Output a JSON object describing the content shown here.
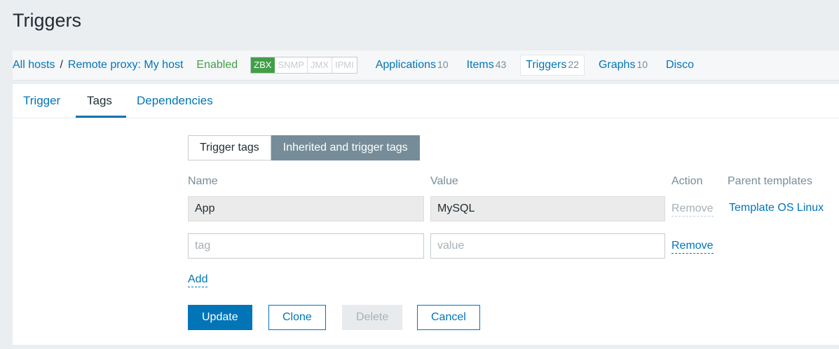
{
  "page": {
    "title": "Triggers"
  },
  "navbar": {
    "breadcrumbs": [
      "All hosts",
      "/",
      "Remote proxy: My host"
    ],
    "status": "Enabled",
    "availability": [
      "ZBX",
      "SNMP",
      "JMX",
      "IPMI"
    ],
    "links": [
      {
        "label": "Applications",
        "count": "10"
      },
      {
        "label": "Items",
        "count": "43"
      },
      {
        "label": "Triggers",
        "count": "22"
      },
      {
        "label": "Graphs",
        "count": "10"
      },
      {
        "label": "Disco",
        "count": ""
      }
    ]
  },
  "tabs": [
    "Trigger",
    "Tags",
    "Dependencies"
  ],
  "segment": [
    "Trigger tags",
    "Inherited and trigger tags"
  ],
  "table": {
    "headers": {
      "name": "Name",
      "value": "Value",
      "action": "Action",
      "parent": "Parent templates"
    },
    "rows": [
      {
        "name": "App",
        "value": "MySQL",
        "action": "Remove",
        "parent": "Template OS Linux"
      }
    ],
    "new_row": {
      "name_placeholder": "tag",
      "value_placeholder": "value",
      "action": "Remove"
    }
  },
  "add_label": "Add",
  "buttons": {
    "update": "Update",
    "clone": "Clone",
    "delete": "Delete",
    "cancel": "Cancel"
  },
  "colors": {
    "accent": "#0275b8",
    "enabled": "#429e47",
    "selected_segment": "#768d99"
  }
}
